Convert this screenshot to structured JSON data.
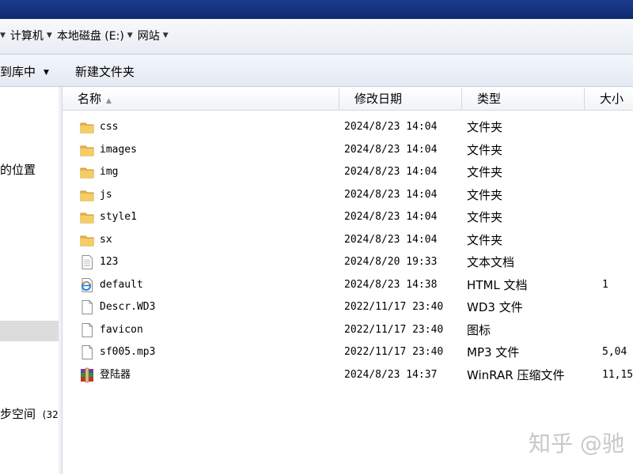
{
  "breadcrumb": [
    {
      "label": "计算机"
    },
    {
      "label": "本地磁盘 (E:)"
    },
    {
      "label": "网站"
    }
  ],
  "toolbar": {
    "include_label": "到库中",
    "new_folder_label": "新建文件夹"
  },
  "nav": {
    "recent_places": "的位置",
    "sync_space": "步空间",
    "sync_space_extra": "(32"
  },
  "columns": {
    "name": "名称",
    "date": "修改日期",
    "type": "类型",
    "size": "大小"
  },
  "files": [
    {
      "name": "css",
      "date": "2024/8/23 14:04",
      "type": "文件夹",
      "size": "",
      "icon": "folder-icon"
    },
    {
      "name": "images",
      "date": "2024/8/23 14:04",
      "type": "文件夹",
      "size": "",
      "icon": "folder-icon"
    },
    {
      "name": "img",
      "date": "2024/8/23 14:04",
      "type": "文件夹",
      "size": "",
      "icon": "folder-icon"
    },
    {
      "name": "js",
      "date": "2024/8/23 14:04",
      "type": "文件夹",
      "size": "",
      "icon": "folder-icon"
    },
    {
      "name": "style1",
      "date": "2024/8/23 14:04",
      "type": "文件夹",
      "size": "",
      "icon": "folder-icon"
    },
    {
      "name": "sx",
      "date": "2024/8/23 14:04",
      "type": "文件夹",
      "size": "",
      "icon": "folder-icon"
    },
    {
      "name": "123",
      "date": "2024/8/20 19:33",
      "type": "文本文档",
      "size": "",
      "icon": "text-file-icon"
    },
    {
      "name": "default",
      "date": "2024/8/23 14:38",
      "type": "HTML 文档",
      "size": "1",
      "icon": "ie-html-icon"
    },
    {
      "name": "Descr.WD3",
      "date": "2022/11/17 23:40",
      "type": "WD3 文件",
      "size": "",
      "icon": "blank-file-icon"
    },
    {
      "name": "favicon",
      "date": "2022/11/17 23:40",
      "type": "图标",
      "size": "",
      "icon": "blank-file-icon"
    },
    {
      "name": "sf005.mp3",
      "date": "2022/11/17 23:40",
      "type": "MP3 文件",
      "size": "5,04",
      "icon": "blank-file-icon"
    },
    {
      "name": "登陆器",
      "date": "2024/8/23 14:37",
      "type": "WinRAR 压缩文件",
      "size": "11,15",
      "icon": "winrar-icon"
    }
  ],
  "watermark": "知乎 @驰"
}
